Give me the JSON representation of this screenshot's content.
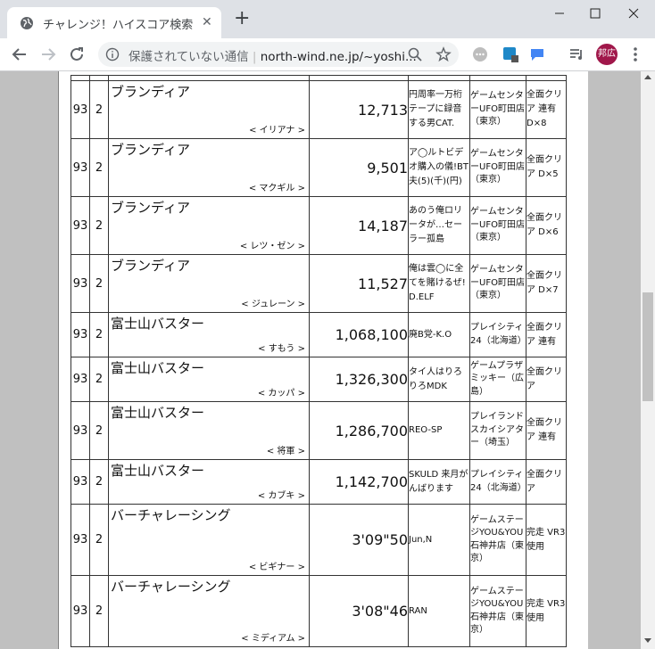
{
  "browser": {
    "tab_title": "チャレンジ！ハイスコア検索",
    "close_label": "✕",
    "new_tab_label": "+",
    "security_label": "保護されていない通信",
    "url": "north-wind.ne.jp/~yoshi...",
    "avatar_label": "邦広"
  },
  "rows": [
    {
      "ver": "93",
      "num": "2",
      "game": "ブランディア",
      "player": "< イリアナ >",
      "score": "12,713",
      "comment": "円周率一万桁テープに録音する男CAT.",
      "shop": "ゲームセンターUFO町田店（東京）",
      "note": "全面クリア 連有 D×8"
    },
    {
      "ver": "93",
      "num": "2",
      "game": "ブランディア",
      "player": "< マクギル >",
      "score": "9,501",
      "comment": "ア◯ルトビデオ購入の儀!BT夫(5)(千)(円)",
      "shop": "ゲームセンターUFO町田店（東京）",
      "note": "全面クリア D×5"
    },
    {
      "ver": "93",
      "num": "2",
      "game": "ブランディア",
      "player": "< レツ・ゼン >",
      "score": "14,187",
      "comment": "あのう俺ロリータが…セーラー孤島",
      "shop": "ゲームセンターUFO町田店（東京）",
      "note": "全面クリア D×6"
    },
    {
      "ver": "93",
      "num": "2",
      "game": "ブランディア",
      "player": "< ジュレーン >",
      "score": "11,527",
      "comment": "俺は雲◯に全てを賭けるぜ!D.ELF",
      "shop": "ゲームセンターUFO町田店（東京）",
      "note": "全面クリア D×7"
    },
    {
      "ver": "93",
      "num": "2",
      "game": "富士山バスター",
      "player": "< すもう >",
      "score": "1,068,100",
      "comment": "廃B党-K.O",
      "shop": "プレイシティ24（北海道）",
      "note": "全面クリア 連有"
    },
    {
      "ver": "93",
      "num": "2",
      "game": "富士山バスター",
      "player": "< カッパ >",
      "score": "1,326,300",
      "comment": "タイ人はりろりろMDK",
      "shop": "ゲームプラザミッキー（広島）",
      "note": "全面クリア"
    },
    {
      "ver": "93",
      "num": "2",
      "game": "富士山バスター",
      "player": "< 将軍 >",
      "score": "1,286,700",
      "comment": "REO-SP",
      "shop": "プレイランドスカイシアター（埼玉）",
      "note": "全面クリア 連有"
    },
    {
      "ver": "93",
      "num": "2",
      "game": "富士山バスター",
      "player": "< カブキ >",
      "score": "1,142,700",
      "comment": "SKULD 来月がんばります",
      "shop": "プレイシティ24（北海道）",
      "note": "全面クリア"
    },
    {
      "ver": "93",
      "num": "2",
      "game": "バーチャレーシング",
      "player": "< ビギナー >",
      "score": "3'09\"50",
      "comment": "Jun,N",
      "shop": "ゲームステージYOU&YOU石神井店（東京）",
      "note": "完走 VR3使用"
    },
    {
      "ver": "93",
      "num": "2",
      "game": "バーチャレーシング",
      "player": "< ミディアム >",
      "score": "3'08\"46",
      "comment": "RAN",
      "shop": "ゲームステージYOU&YOU石神井店（東京）",
      "note": "完走 VR3使用"
    }
  ]
}
